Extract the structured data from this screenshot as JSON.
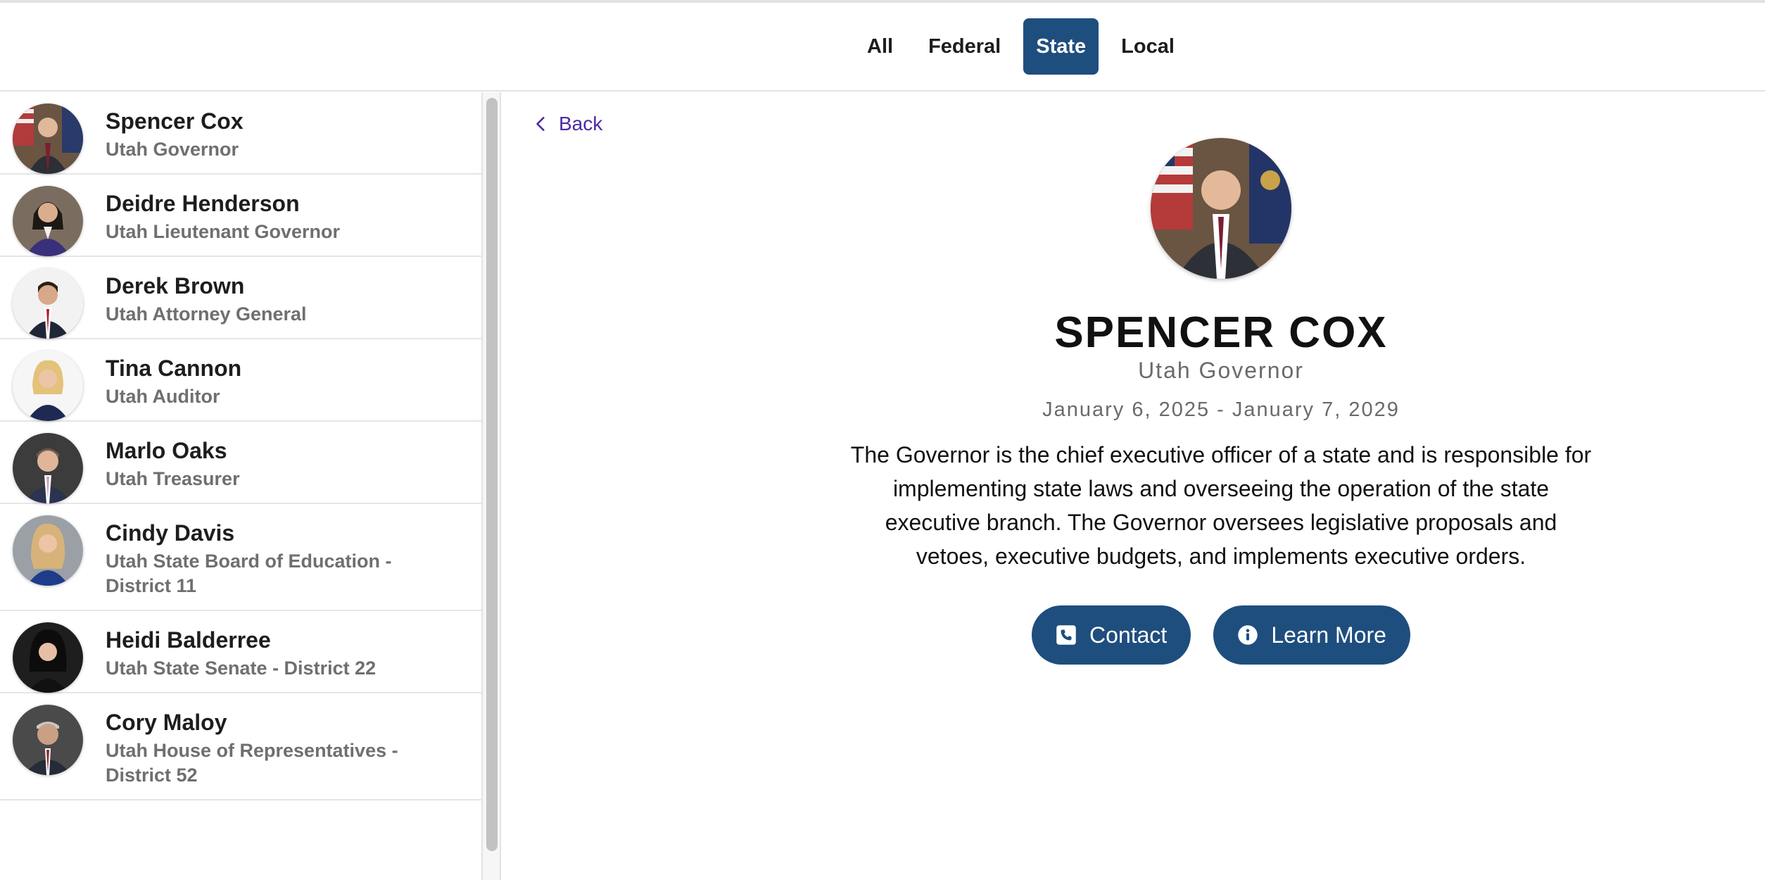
{
  "tabs": [
    {
      "label": "All",
      "active": false
    },
    {
      "label": "Federal",
      "active": false
    },
    {
      "label": "State",
      "active": true
    },
    {
      "label": "Local",
      "active": false
    }
  ],
  "sidebar": {
    "items": [
      {
        "name": "Spencer Cox",
        "role": "Utah Governor",
        "avatar_bg": "#5b4a3a"
      },
      {
        "name": "Deidre Henderson",
        "role": "Utah Lieutenant Governor",
        "avatar_bg": "#6b5e52"
      },
      {
        "name": "Derek Brown",
        "role": "Utah Attorney General",
        "avatar_bg": "#f2f2f2"
      },
      {
        "name": "Tina Cannon",
        "role": "Utah Auditor",
        "avatar_bg": "#f5f5f5"
      },
      {
        "name": "Marlo Oaks",
        "role": "Utah Treasurer",
        "avatar_bg": "#3a3a3a"
      },
      {
        "name": "Cindy Davis",
        "role": "Utah State Board of Education - District 11",
        "avatar_bg": "#9aa0a6"
      },
      {
        "name": "Heidi Balderree",
        "role": "Utah State Senate - District 22",
        "avatar_bg": "#1e1e1e"
      },
      {
        "name": "Cory Maloy",
        "role": "Utah House of Representatives - District 52",
        "avatar_bg": "#4a4a4a"
      }
    ]
  },
  "back": {
    "label": "Back"
  },
  "detail": {
    "name": "SPENCER COX",
    "role": "Utah Governor",
    "term": "January 6, 2025 - January 7, 2029",
    "description": "The Governor is the chief executive officer of a state and is responsible for implementing state laws and overseeing the operation of the state executive branch. The Governor oversees legislative proposals and vetoes, executive budgets, and implements executive orders.",
    "contact_label": "Contact",
    "learn_more_label": "Learn More"
  },
  "colors": {
    "accent": "#1e4e7e",
    "link": "#4b2aa6",
    "muted": "#6f6f6f"
  },
  "icons": {
    "back": "chevron-left-icon",
    "contact": "phone-square-icon",
    "learn_more": "info-circle-icon"
  }
}
